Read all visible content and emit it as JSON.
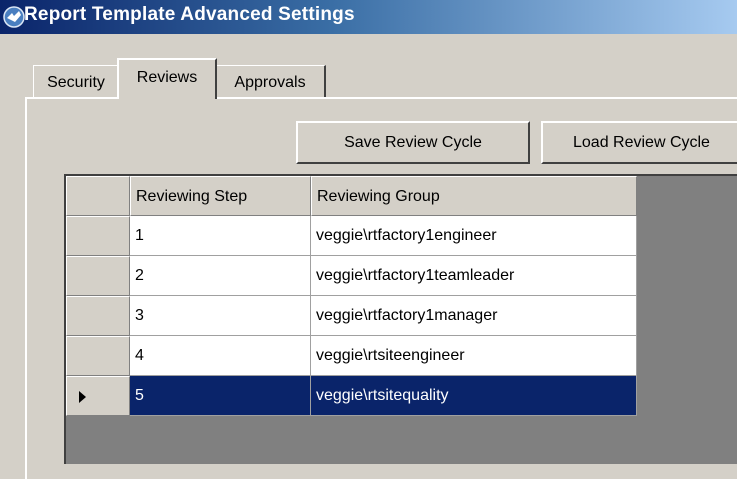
{
  "window": {
    "title": "Report Template Advanced Settings",
    "title_gradient": [
      "#0a246a",
      "#a6caf0"
    ],
    "icon": "app-icon"
  },
  "tabs": [
    {
      "label": "Security",
      "active": false
    },
    {
      "label": "Reviews",
      "active": true
    },
    {
      "label": "Approvals",
      "active": false
    }
  ],
  "buttons": {
    "save_label": "Save Review Cycle",
    "load_label": "Load Review Cycle"
  },
  "grid": {
    "columns": [
      "Reviewing Step",
      "Reviewing Group"
    ],
    "rows": [
      {
        "step": "1",
        "group": "veggie\\rtfactory1engineer",
        "selected": false
      },
      {
        "step": "2",
        "group": "veggie\\rtfactory1teamleader",
        "selected": false
      },
      {
        "step": "3",
        "group": "veggie\\rtfactory1manager",
        "selected": false
      },
      {
        "step": "4",
        "group": "veggie\\rtsiteengineer",
        "selected": false
      },
      {
        "step": "5",
        "group": "veggie\\rtsitequality",
        "selected": true
      }
    ],
    "selection_color": "#0a246a",
    "current_row_icon": "row-pointer-icon"
  }
}
